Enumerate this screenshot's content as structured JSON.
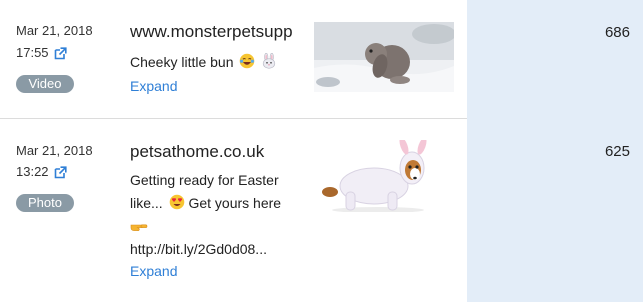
{
  "posts": [
    {
      "date": "Mar 21, 2018",
      "time": "17:55",
      "type": "Video",
      "source": "www.monsterpetsupp",
      "text_line1": "Cheeky little bun",
      "expand": "Expand",
      "value": "686",
      "icons": [
        "external-link-icon",
        "laughing-tears-emoji-icon",
        "rabbit-face-emoji-icon"
      ]
    },
    {
      "date": "Mar 21, 2018",
      "time": "13:22",
      "type": "Photo",
      "source": "petsathome.co.uk",
      "text_line1": "Getting ready for Easter",
      "text_line2": "like... ",
      "text_line2_rest": " Get yours here",
      "text_line4": "http://bit.ly/2Gd0d08...",
      "expand": "Expand",
      "value": "625",
      "icons": [
        "external-link-icon",
        "heart-eyes-emoji-icon",
        "pointing-hand-emoji-icon"
      ]
    }
  ],
  "colors": {
    "link": "#2f7fd6",
    "badge": "#8a9aa5",
    "metric_column": "#e3edf8"
  }
}
